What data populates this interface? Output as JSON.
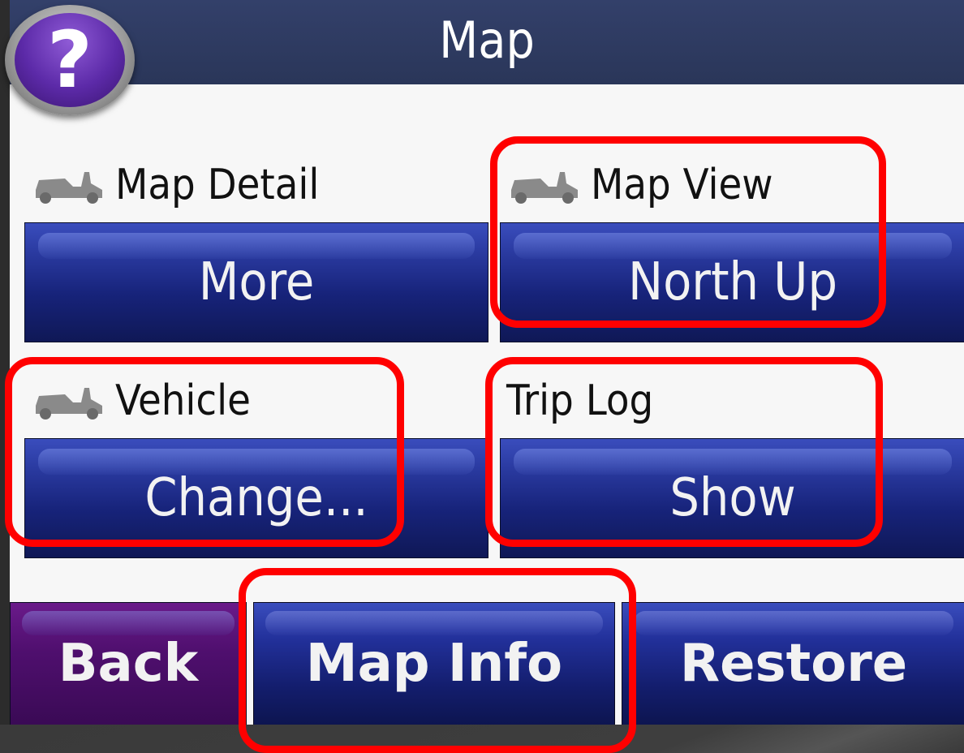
{
  "header": {
    "title": "Map",
    "help_icon_glyph": "?"
  },
  "settings": [
    {
      "label": "Map Detail",
      "value": "More",
      "has_vehicle_icon": true
    },
    {
      "label": "Map View",
      "value": "North Up",
      "has_vehicle_icon": true
    },
    {
      "label": "Vehicle",
      "value": "Change...",
      "has_vehicle_icon": true
    },
    {
      "label": "Trip Log",
      "value": "Show",
      "has_vehicle_icon": false
    }
  ],
  "bottom_bar": {
    "back_label": "Back",
    "map_info_label": "Map Info",
    "restore_label": "Restore"
  },
  "colors": {
    "header": "#2f3b62",
    "button_blue": "#17237a",
    "back_purple": "#4f0f6e",
    "highlight": "#ff0000"
  }
}
